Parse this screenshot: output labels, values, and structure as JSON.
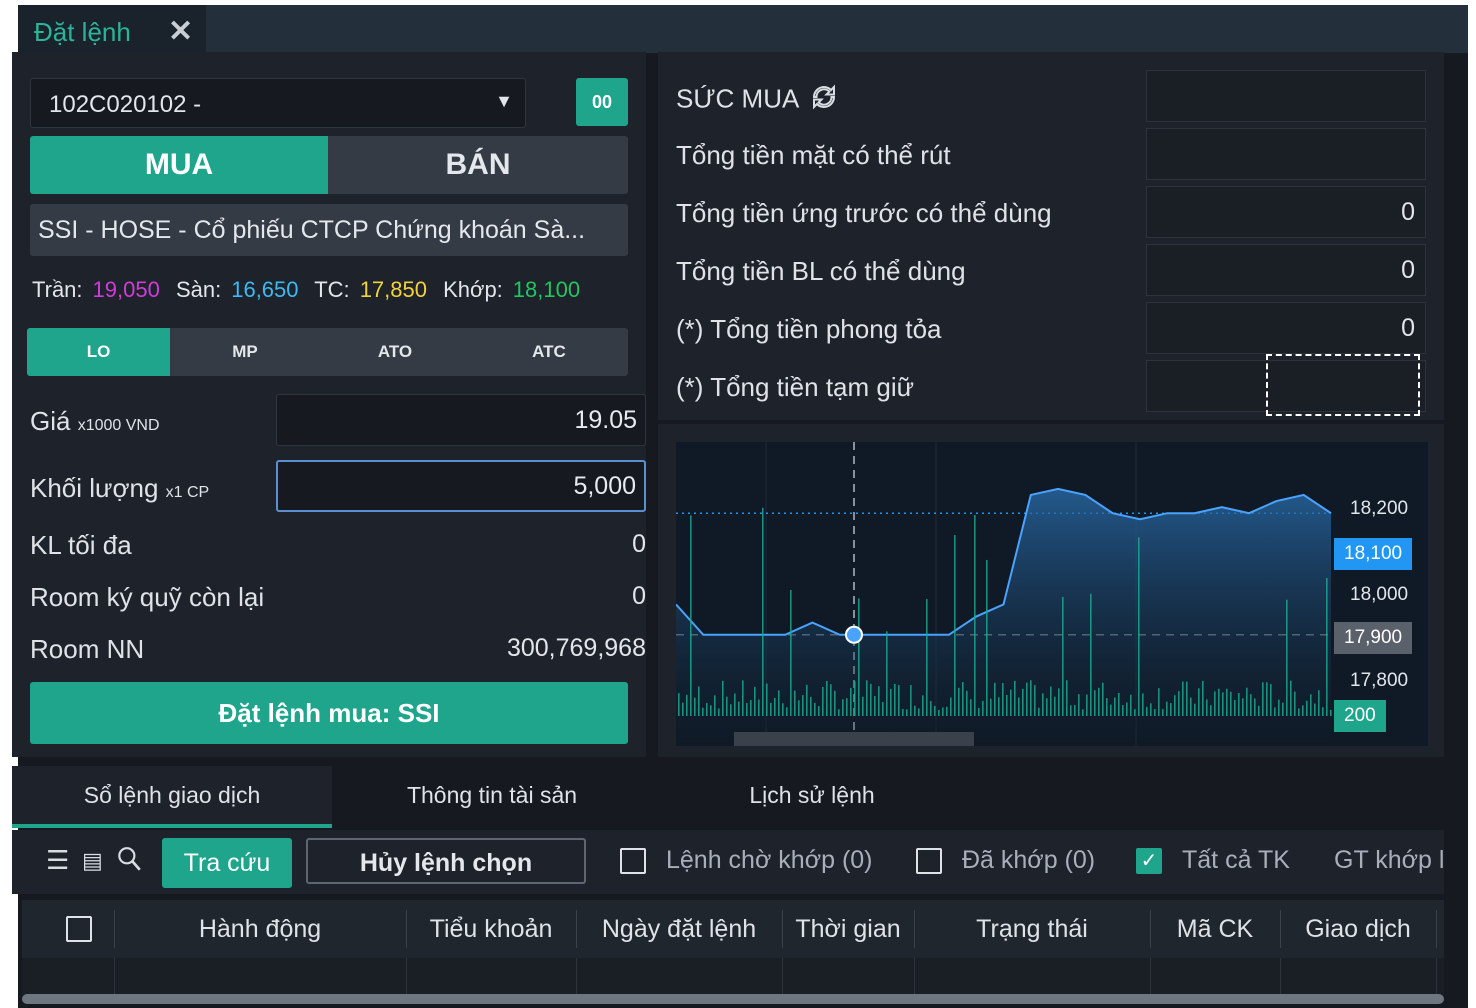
{
  "window": {
    "tab_title": "Đặt lệnh",
    "close_glyph": "✕"
  },
  "order": {
    "account": "102C020102 -",
    "oo_label": "00",
    "buy_label": "MUA",
    "sell_label": "BÁN",
    "symbol": "SSI - HOSE - Cổ phiếu CTCP Chứng khoán Sà...",
    "prices": {
      "ceil_label": "Trần:",
      "ceil": "19,050",
      "floor_label": "Sàn:",
      "floor": "16,650",
      "ref_label": "TC:",
      "ref": "17,850",
      "match_label": "Khớp:",
      "match": "18,100"
    },
    "order_types": [
      "LO",
      "MP",
      "ATO",
      "ATC"
    ],
    "price_label": "Giá",
    "price_unit": "x1000 VND",
    "price_value": "19.05",
    "qty_label": "Khối lượng",
    "qty_unit": "x1 CP",
    "qty_value": "5,000",
    "max_qty_label": "KL tối đa",
    "max_qty": "0",
    "margin_room_label": "Room ký quỹ còn lại",
    "margin_room": "0",
    "foreign_room_label": "Room NN",
    "foreign_room": "300,769,968",
    "submit_label": "Đặt lệnh mua: SSI"
  },
  "account_info": {
    "buying_power_label": "SỨC MUA",
    "buying_power": "",
    "cash_withdrawable_label": "Tổng tiền mặt có thể rút",
    "cash_withdrawable": "",
    "advance_label": "Tổng tiền ứng trước có thể dùng",
    "advance": "0",
    "guarantee_label": "Tổng tiền BL có thể dùng",
    "guarantee": "0",
    "blocked_label": "(*) Tổng tiền phong tỏa",
    "blocked": "0",
    "held_label": "(*) Tổng tiền tạm giữ",
    "held": ""
  },
  "chart": {
    "y_labels": [
      "18,200",
      "18,100",
      "18,000",
      "17,900",
      "17,800"
    ],
    "current_badge": "18,100",
    "ref_badge": "17,900",
    "volume_badge": "200",
    "colors": {
      "current": "#2196f3",
      "ref": "#5a616b",
      "volume": "#1fa58c"
    }
  },
  "chart_data": {
    "type": "line",
    "y_ticks": [
      17800,
      17900,
      18000,
      18100,
      18200
    ],
    "current_price": 18100,
    "series": [
      {
        "values": [
          17950,
          17900,
          17900,
          17900,
          17900,
          17920,
          17900,
          17900,
          17900,
          17900,
          17900,
          17930,
          17950,
          18130,
          18140,
          18130,
          18100,
          18090,
          18100,
          18100,
          18110,
          18100,
          18120,
          18130,
          18100
        ]
      }
    ],
    "volume_label": 200
  },
  "bottom": {
    "tabs": [
      "Sổ lệnh giao dịch",
      "Thông tin tài sản",
      "Lịch sử lệnh"
    ],
    "search_label": "Tra cứu",
    "cancel_selected_label": "Hủy lệnh chọn",
    "filters": [
      {
        "label": "Lệnh chờ khớp (0)",
        "checked": false
      },
      {
        "label": "Đã khớp (0)",
        "checked": false
      },
      {
        "label": "Tất cả TK",
        "checked": true
      },
      {
        "label": "GT khớp l",
        "checked": false
      }
    ],
    "columns": [
      "Hành động",
      "Tiểu khoản",
      "Ngày đặt lệnh",
      "Thời gian",
      "Trạng thái",
      "Mã CK",
      "Giao dịch"
    ]
  }
}
